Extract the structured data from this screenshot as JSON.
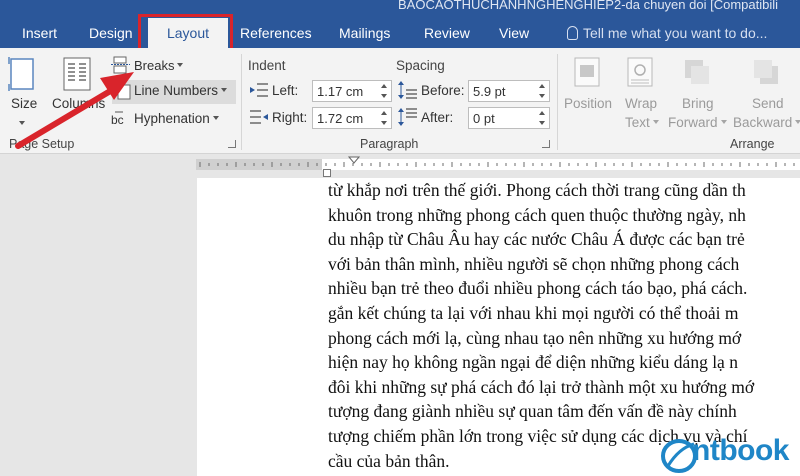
{
  "window": {
    "title": "BAOCAOTHUCHANHNGHENGHIEP2-da chuyen doi [Compatibili"
  },
  "tabs": [
    {
      "label": "Insert"
    },
    {
      "label": "Design"
    },
    {
      "label": "Layout",
      "active": true
    },
    {
      "label": "References"
    },
    {
      "label": "Mailings"
    },
    {
      "label": "Review"
    },
    {
      "label": "View"
    }
  ],
  "tell_me": {
    "placeholder": "Tell me what you want to do..."
  },
  "ribbon": {
    "page_setup": {
      "label": "Page Setup",
      "size": "Size",
      "columns": "Columns",
      "breaks": "Breaks",
      "line_numbers": "Line Numbers",
      "hyphenation": "Hyphenation"
    },
    "paragraph": {
      "label": "Paragraph",
      "indent_heading": "Indent",
      "spacing_heading": "Spacing",
      "left_label": "Left:",
      "left_value": "1.17 cm",
      "right_label": "Right:",
      "right_value": "1.72 cm",
      "before_label": "Before:",
      "before_value": "5.9 pt",
      "after_label": "After:",
      "after_value": "0 pt"
    },
    "arrange": {
      "label": "Arrange",
      "position": "Position",
      "wrap_text_1": "Wrap",
      "wrap_text_2": "Text",
      "bring_forward_1": "Bring",
      "bring_forward_2": "Forward",
      "send_backward_1": "Send",
      "send_backward_2": "Backward"
    }
  },
  "document": {
    "lines": [
      "từ khắp nơi trên thế giới. Phong cách thời trang cũng dần th",
      "khuôn trong những phong cách quen thuộc thường ngày, nh",
      "du nhập từ Châu Âu hay các nước Châu Á được các bạn trẻ",
      "với bản thân mình, nhiều người sẽ chọn những phong cách",
      "nhiều bạn trẻ theo đuổi nhiều phong cách táo bạo, phá cách.",
      "gắn kết chúng ta lại với nhau khi mọi người có thể thoải m",
      "phong cách mới lạ, cùng nhau tạo nên những xu hướng mớ",
      "hiện nay họ không ngần ngại để diện những kiểu dáng lạ n",
      "đôi khi những sự phá cách đó lại trở thành một xu hướng mớ",
      "tượng đang giành nhiều sự quan tâm đến vấn đề này chính",
      "tượng chiếm phần lớn trong việc sử dụng các dịch vụ và chí",
      "cầu của bản thân."
    ]
  },
  "watermark": {
    "text": "ntbook"
  },
  "colors": {
    "ribbon_blue": "#2b579a",
    "highlight_red": "#d9242b",
    "watermark_blue": "#1f86c7"
  }
}
